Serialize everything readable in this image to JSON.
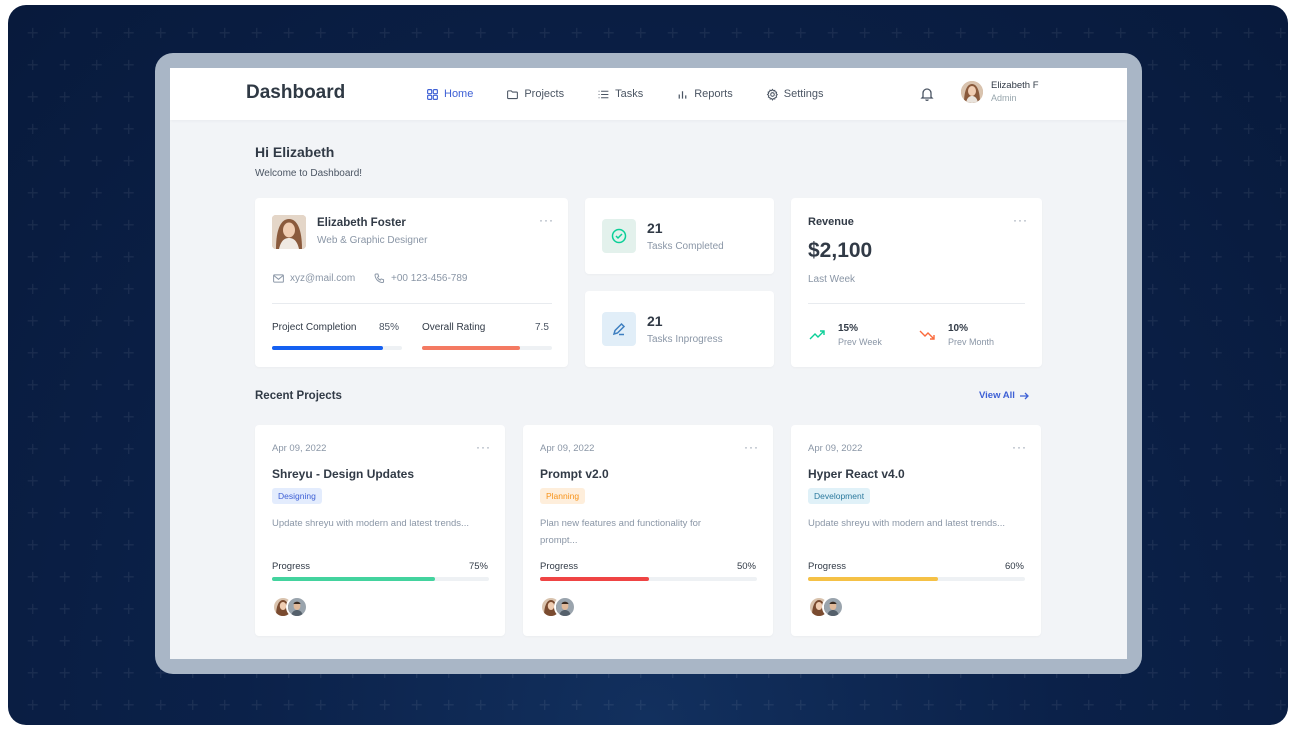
{
  "app": {
    "title": "Dashboard"
  },
  "nav": [
    {
      "label": "Home",
      "icon": "grid-icon",
      "active": true
    },
    {
      "label": "Projects",
      "icon": "folder-icon",
      "active": false
    },
    {
      "label": "Tasks",
      "icon": "list-icon",
      "active": false
    },
    {
      "label": "Reports",
      "icon": "bar-chart-icon",
      "active": false
    },
    {
      "label": "Settings",
      "icon": "gear-icon",
      "active": false
    }
  ],
  "user": {
    "name": "Elizabeth F",
    "role": "Admin"
  },
  "greeting": {
    "title": "Hi Elizabeth",
    "subtitle": "Welcome to Dashboard!"
  },
  "profile": {
    "name": "Elizabeth Foster",
    "title": "Web & Graphic Designer",
    "email": "xyz@mail.com",
    "phone": "+00 123-456-789",
    "completion_label": "Project Completion",
    "completion_value": "85%",
    "completion_fraction": 0.85,
    "rating_label": "Overall Rating",
    "rating_value": "7.5",
    "rating_fraction": 0.75
  },
  "stats": [
    {
      "value": "21",
      "label": "Tasks Completed",
      "icon": "check-circle-icon"
    },
    {
      "value": "21",
      "label": "Tasks Inprogress",
      "icon": "edit-pen-icon"
    }
  ],
  "revenue": {
    "title": "Revenue",
    "amount": "$2,100",
    "period": "Last Week",
    "trends": [
      {
        "pct": "15%",
        "label": "Prev Week",
        "direction": "up",
        "color": "#0acf97"
      },
      {
        "pct": "10%",
        "label": "Prev Month",
        "direction": "down",
        "color": "#fa5c7c"
      }
    ]
  },
  "recent": {
    "title": "Recent Projects",
    "view_all": "View All"
  },
  "projects": [
    {
      "date": "Apr 09, 2022",
      "name": "Shreyu - Design Updates",
      "tag": "Designing",
      "tag_color": "#3e60d5",
      "tag_bg": "#e3ecfd",
      "desc": "Update shreyu with modern and latest trends...",
      "progress_label": "Progress",
      "progress_value": "75%",
      "progress_fraction": 0.75,
      "bar_color": "#43d39e"
    },
    {
      "date": "Apr 09, 2022",
      "name": "Prompt v2.0",
      "tag": "Planning",
      "tag_color": "#f7931a",
      "tag_bg": "#feeedb",
      "desc": "Plan new features and functionality for prompt...",
      "progress_label": "Progress",
      "progress_value": "50%",
      "progress_fraction": 0.5,
      "bar_color": "#ef4444"
    },
    {
      "date": "Apr 09, 2022",
      "name": "Hyper React v4.0",
      "tag": "Development",
      "tag_color": "#2c7a9e",
      "tag_bg": "#e0f1f8",
      "desc": "Update shreyu with modern and latest trends...",
      "progress_label": "Progress",
      "progress_value": "60%",
      "progress_fraction": 0.6,
      "bar_color": "#f5c146"
    }
  ],
  "colors": {
    "accent": "#3e60d5",
    "completion_bar": "#1560f1",
    "rating_bar": "#f47a62",
    "success": "#0acf97"
  }
}
